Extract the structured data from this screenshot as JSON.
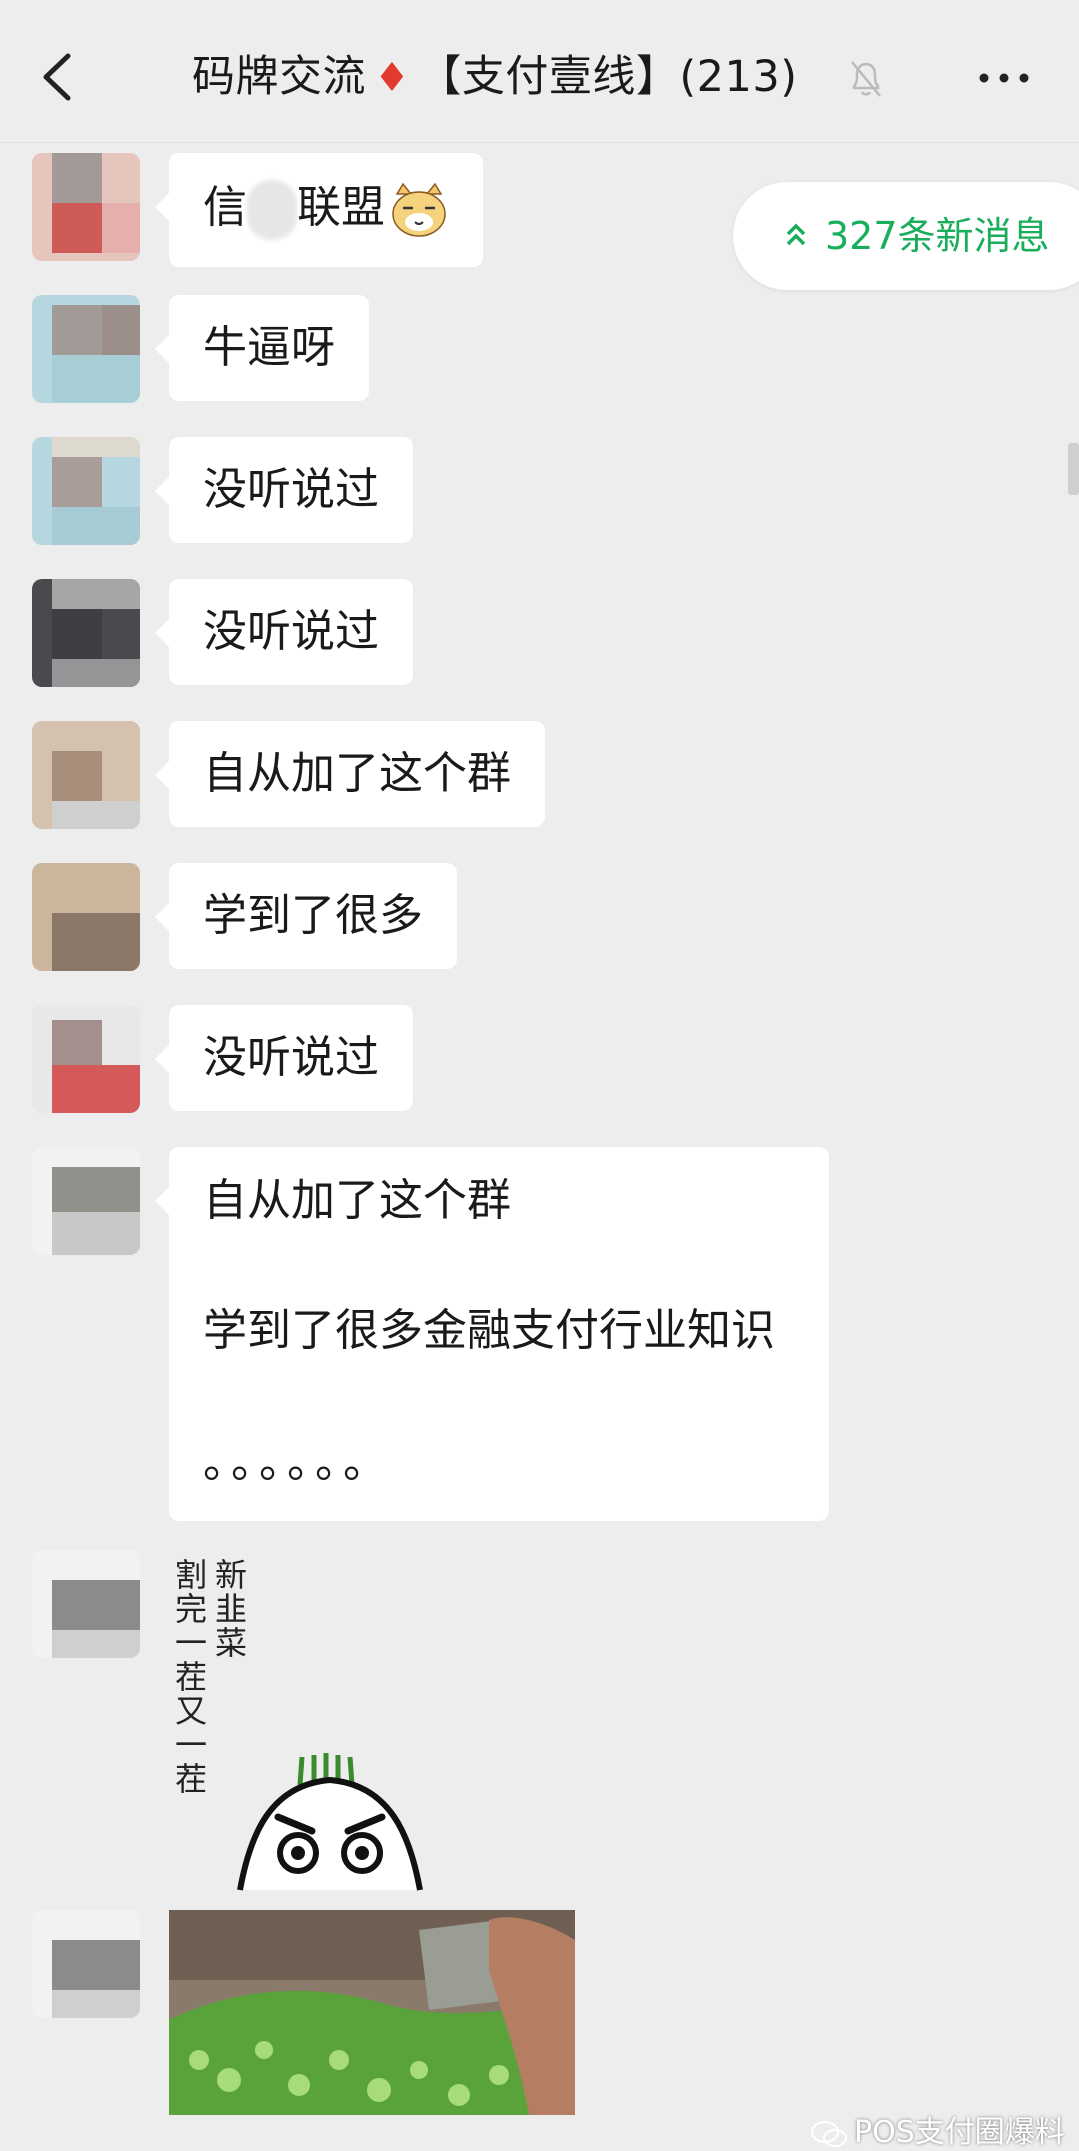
{
  "header": {
    "title_prefix": "码牌交流",
    "title_diamond": "♦",
    "title_suffix": "【支付壹线】(213)",
    "back_icon": "chevron-left-icon",
    "mute_icon": "bell-muted-icon",
    "more_icon": "ellipsis-icon"
  },
  "new_messages": {
    "label": "327条新消息",
    "icon": "double-chevron-up-icon"
  },
  "messages": [
    {
      "part1": "信",
      "part2": "联盟",
      "emoji": "cat-face-emoji"
    },
    {
      "text": "牛逼呀"
    },
    {
      "text": "没听说过"
    },
    {
      "text": "没听说过"
    },
    {
      "text": "自从加了这个群"
    },
    {
      "text": "学到了很多"
    },
    {
      "text": "没听说过"
    },
    {
      "lines": [
        "自从加了这个群",
        "学到了很多金融支付行业知识",
        "。。。。。。"
      ]
    },
    {
      "sticker_col1": "新韭菜",
      "sticker_col2": "割完一茬又一茬"
    }
  ],
  "watermark": "POS支付圈爆料",
  "colors": {
    "accent_green": "#1aad5c",
    "diamond_red": "#e23a2e",
    "background": "#ededed"
  }
}
